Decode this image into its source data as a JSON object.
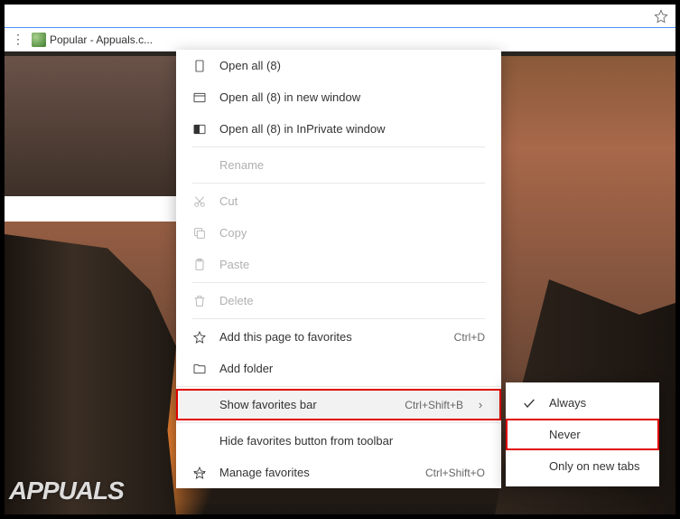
{
  "browser": {
    "bookmark_title": "Popular - Appuals.c..."
  },
  "menu": {
    "open_all": "Open all (8)",
    "open_all_window": "Open all (8) in new window",
    "open_all_inprivate": "Open all (8) in InPrivate window",
    "rename": "Rename",
    "cut": "Cut",
    "copy": "Copy",
    "paste": "Paste",
    "delete": "Delete",
    "add_page": "Add this page to favorites",
    "add_page_shortcut": "Ctrl+D",
    "add_folder": "Add folder",
    "show_favorites": "Show favorites bar",
    "show_favorites_shortcut": "Ctrl+Shift+B",
    "hide_button": "Hide favorites button from toolbar",
    "manage": "Manage favorites",
    "manage_shortcut": "Ctrl+Shift+O"
  },
  "submenu": {
    "always": "Always",
    "never": "Never",
    "new_tabs": "Only on new tabs"
  },
  "watermark": "APPUALS"
}
